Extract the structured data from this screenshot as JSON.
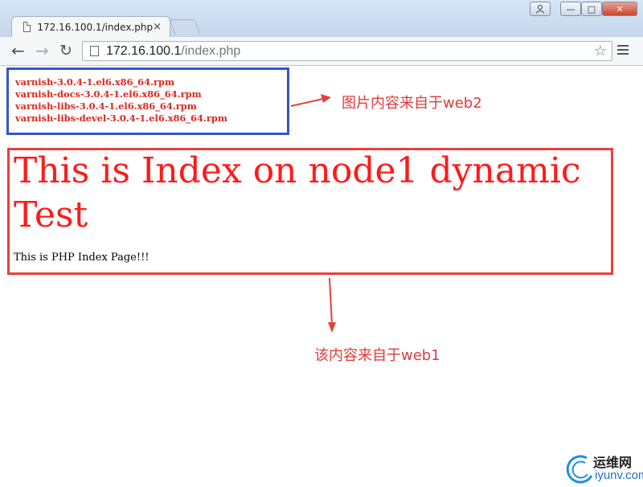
{
  "browser": {
    "tab_title": "172.16.100.1/index.php",
    "tab_close": "×",
    "url_host": "172.16.100.1",
    "url_path": "/index.php",
    "window_buttons": {
      "user": "👤",
      "min": "—",
      "max": "□",
      "close": "✕"
    },
    "nav": {
      "back": "←",
      "forward": "→",
      "reload": "↻",
      "star": "☆"
    }
  },
  "page": {
    "rpm_files": [
      "varnish-3.0.4-1.el6.x86_64.rpm",
      "varnish-docs-3.0.4-1.el6.x86_64.rpm",
      "varnish-libs-3.0.4-1.el6.x86_64.rpm",
      "varnish-libs-devel-3.0.4-1.el6.x86_64.rpm"
    ],
    "heading": "This is Index on node1 dynamic Test",
    "subtext": "This is PHP Index Page!!!"
  },
  "annotations": {
    "image_source": "图片内容来自于web2",
    "content_source": "该内容来自于web1"
  },
  "watermark": {
    "line1": "运维网",
    "line2": "iyunv.com"
  },
  "colors": {
    "annotation_red": "#e03a3a",
    "rpm_box_blue": "#3555c8",
    "heading_red": "#ff1a1a"
  }
}
